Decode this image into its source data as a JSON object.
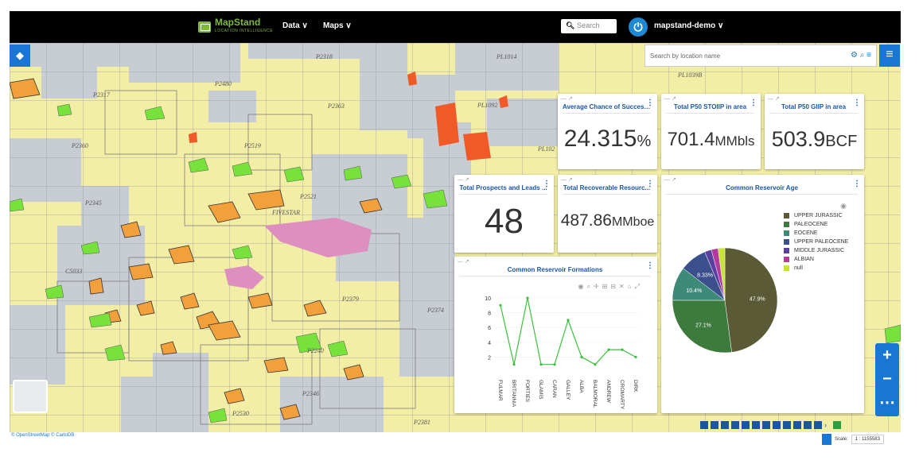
{
  "header": {
    "logo_name": "MapStand",
    "logo_tagline": "LOCATION INTELLIGENCE",
    "nav_data": "Data ∨",
    "nav_maps": "Maps ∨",
    "search_placeholder": "Search",
    "user": "mapstand-demo ∨"
  },
  "map": {
    "location_search_placeholder": "Search by location name",
    "block_labels": [
      "P2318",
      "P2480",
      "P2317",
      "P2363",
      "P2360",
      "P2519",
      "P2345",
      "FIVESTAR",
      "P2521",
      "C5033",
      "P2379",
      "P2374",
      "P2346",
      "P2530",
      "P2381",
      "P2240",
      "PL1039B",
      "PL1092",
      "PL1014",
      "PL102"
    ],
    "credit": "© OpenStreetMap © CartoDB",
    "scale_label": "Scale:",
    "scale_value": "1 : 1155583"
  },
  "panels": {
    "avg_chance": {
      "title": "Average Chance of Success ...",
      "value": "24.315",
      "unit": "%"
    },
    "stoiip": {
      "title": "Total P50 STOIIP in area",
      "value": "701.4",
      "unit": "MMbls"
    },
    "giip": {
      "title": "Total P50 GIIP in area",
      "value": "503.9",
      "unit": "BCF"
    },
    "prospects": {
      "title": "Total Prospects and Leads ...",
      "value": "48"
    },
    "recoverable": {
      "title": "Total Recoverable Resourc...",
      "value": "487.86",
      "unit": "MMboe"
    },
    "formations": {
      "title": "Common Reservoir Formations"
    },
    "age": {
      "title": "Common Reservoir Age"
    }
  },
  "chart_data": [
    {
      "type": "line",
      "title": "Common Reservoir Formations",
      "categories": [
        "FULMAR",
        "BRITANNIA",
        "FORTIES",
        "GLAMIS",
        "CARAN",
        "GALLEY",
        "ALBA",
        "BALMORAL",
        "ANDREW",
        "CROMARTY",
        "DIRK"
      ],
      "values": [
        9,
        1,
        10,
        1,
        1,
        7,
        2,
        1,
        3,
        3,
        2
      ],
      "ylim": [
        0,
        10
      ],
      "yticks": [
        2,
        4,
        6,
        8,
        10
      ],
      "color": "#3cc13c"
    },
    {
      "type": "pie",
      "title": "Common Reservoir Age",
      "slices": [
        {
          "label": "UPPER JURASSIC",
          "value": 47.9,
          "color": "#5a5a36"
        },
        {
          "label": "PALEOCENE",
          "value": 27.1,
          "color": "#3d7a3d"
        },
        {
          "label": "EOCENE",
          "value": 10.4,
          "color": "#3e8a78"
        },
        {
          "label": "UPPER PALEOCENE",
          "value": 8.33,
          "color": "#3a4f8c"
        },
        {
          "label": "MIDDLE JURASSIC",
          "value": 2.08,
          "color": "#5b3fa0"
        },
        {
          "label": "ALBIAN",
          "value": 2.08,
          "color": "#b43aa0"
        },
        {
          "label": "null",
          "value": 2.08,
          "color": "#c6e33a"
        }
      ],
      "data_labels": [
        "47.9%",
        "27.1%",
        "10.4%",
        "8.33%"
      ]
    }
  ],
  "colors": {
    "accent": "#1976d2",
    "header": "#000000",
    "title_blue": "#1a56a6"
  }
}
